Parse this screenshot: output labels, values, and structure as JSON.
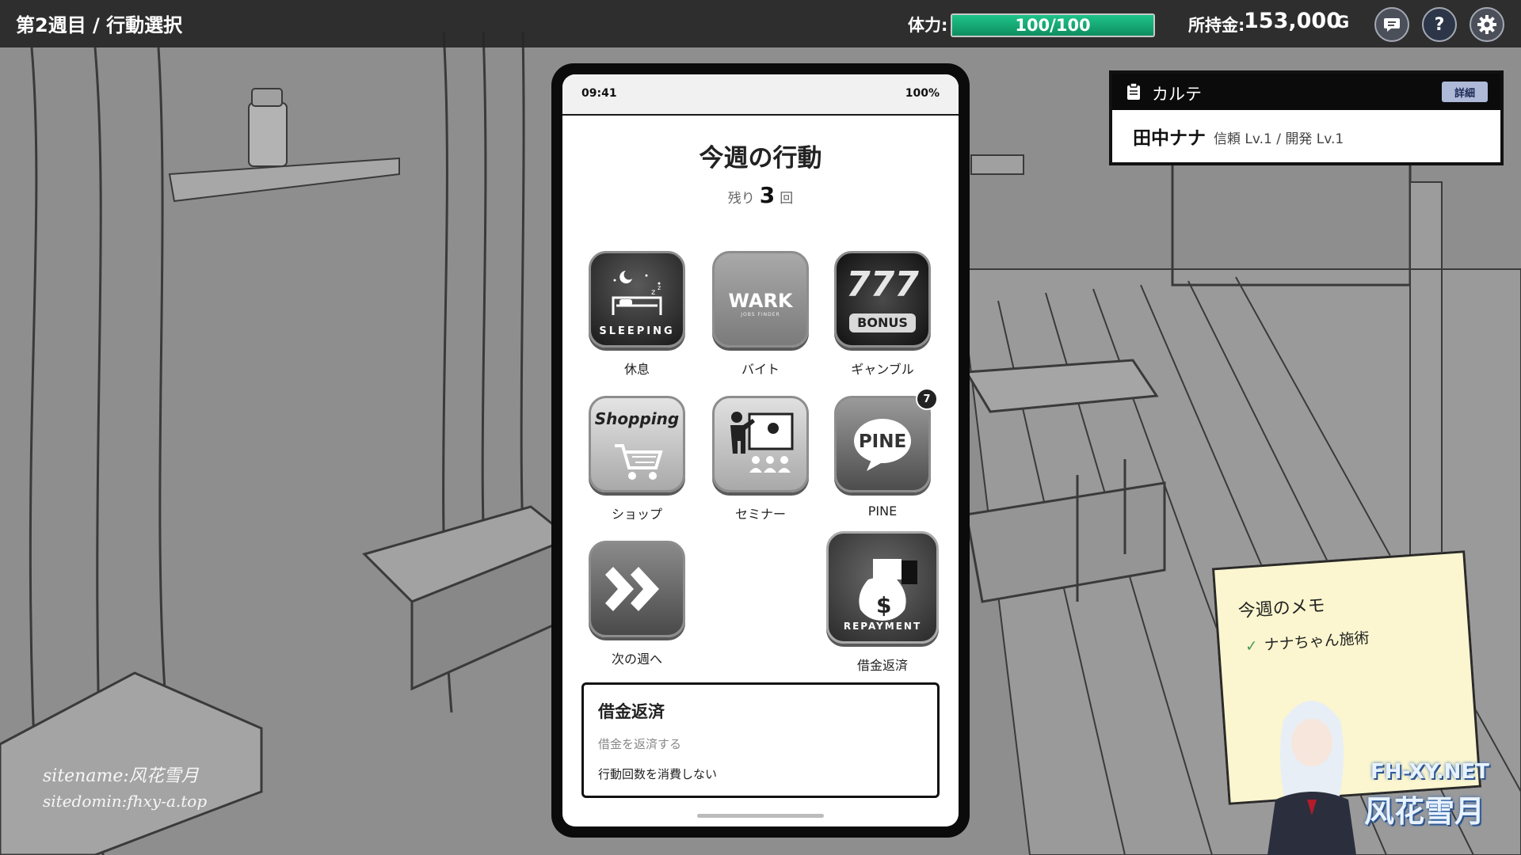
{
  "header": {
    "breadcrumb": "第2週目 / 行動選択",
    "stamina_label": "体力:",
    "stamina_value": "100/100",
    "stamina_fraction": 1.0,
    "money_label": "所持金:",
    "money_value": "153,000",
    "money_unit": "G",
    "buttons": [
      {
        "name": "chat-button",
        "icon": "chat-bubble-icon"
      },
      {
        "name": "help-button",
        "icon": "question-icon",
        "glyph": "?"
      },
      {
        "name": "settings-button",
        "icon": "gear-icon"
      }
    ]
  },
  "phone": {
    "time": "09:41",
    "battery": "100%",
    "title": "今週の行動",
    "remaining_prefix": "残り",
    "remaining_count": "3",
    "remaining_suffix": "回",
    "apps": [
      {
        "label": "休息",
        "icon_text": "SLEEPING",
        "icon": "sleeping-icon"
      },
      {
        "label": "バイト",
        "icon_text": "WARK",
        "icon_subtext": "JOBS FINDER",
        "icon": "wark-icon"
      },
      {
        "label": "ギャンブル",
        "icon_text": "777",
        "icon_subtext": "BONUS",
        "icon": "slot-icon"
      },
      {
        "label": "ショップ",
        "icon_text": "Shopping",
        "icon": "shopping-cart-icon"
      },
      {
        "label": "セミナー",
        "icon": "seminar-icon"
      },
      {
        "label": "PINE",
        "icon_text": "PINE",
        "badge": "7",
        "icon": "pine-chat-icon"
      },
      {
        "label": "次の週へ",
        "icon": "fast-forward-icon"
      },
      {
        "label": "借金返済",
        "icon_text": "REPAYMENT",
        "icon": "money-bag-icon"
      }
    ],
    "info": {
      "title": "借金返済",
      "description": "借金を返済する",
      "note": "行動回数を消費しない"
    }
  },
  "karte": {
    "title": "カルテ",
    "detail_button": "詳細",
    "name": "田中ナナ",
    "levels": "信頼 Lv.1 / 開発 Lv.1"
  },
  "memo": {
    "title": "今週のメモ",
    "items": [
      "ナナちゃん施術"
    ]
  },
  "watermark": {
    "line1": "sitename:风花雪月",
    "line2": "sitedomin:fhxy-a.top",
    "logo_top": "FH-XY.NET",
    "logo_bottom": "风花雪月"
  },
  "colors": {
    "stamina_fill": "#1fc48a",
    "topbar": "#262626",
    "memo_paper": "#fbf6cf",
    "detail_button": "#aeb9d8"
  }
}
